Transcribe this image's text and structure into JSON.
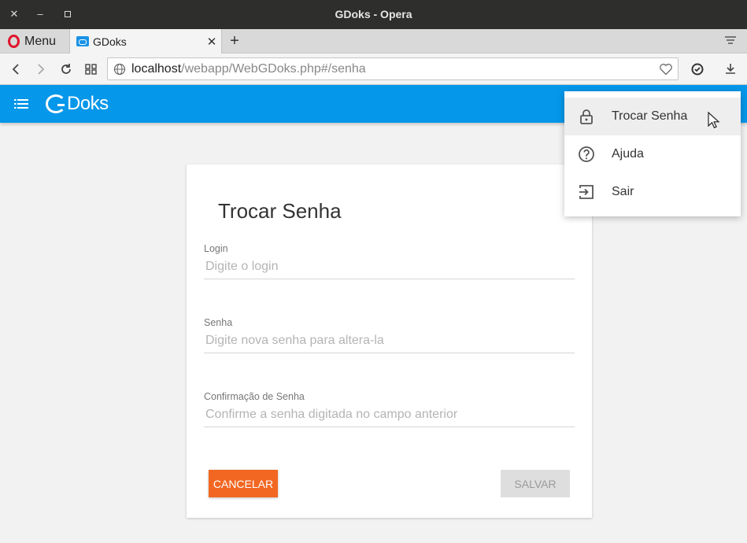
{
  "window": {
    "title": "GDoks - Opera"
  },
  "browser": {
    "menu_label": "Menu",
    "tab": {
      "title": "GDoks"
    },
    "url": {
      "host": "localhost",
      "path": "/webapp/WebGDoks.php#/senha"
    }
  },
  "app": {
    "logo_first": "G",
    "logo_rest": "Doks",
    "accent": "#0597ea"
  },
  "form": {
    "title": "Trocar Senha",
    "fields": [
      {
        "label": "Login",
        "placeholder": "Digite o login"
      },
      {
        "label": "Senha",
        "placeholder": "Digite nova senha para altera-la"
      },
      {
        "label": "Confirmação de Senha",
        "placeholder": "Confirme a senha digitada no campo anterior"
      }
    ],
    "cancel_label": "CANCELAR",
    "save_label": "SALVAR",
    "cancel_color": "#f26722"
  },
  "user_menu": {
    "items": [
      {
        "label": "Trocar Senha",
        "icon": "lock-icon"
      },
      {
        "label": "Ajuda",
        "icon": "help-icon"
      },
      {
        "label": "Sair",
        "icon": "exit-icon"
      }
    ]
  }
}
